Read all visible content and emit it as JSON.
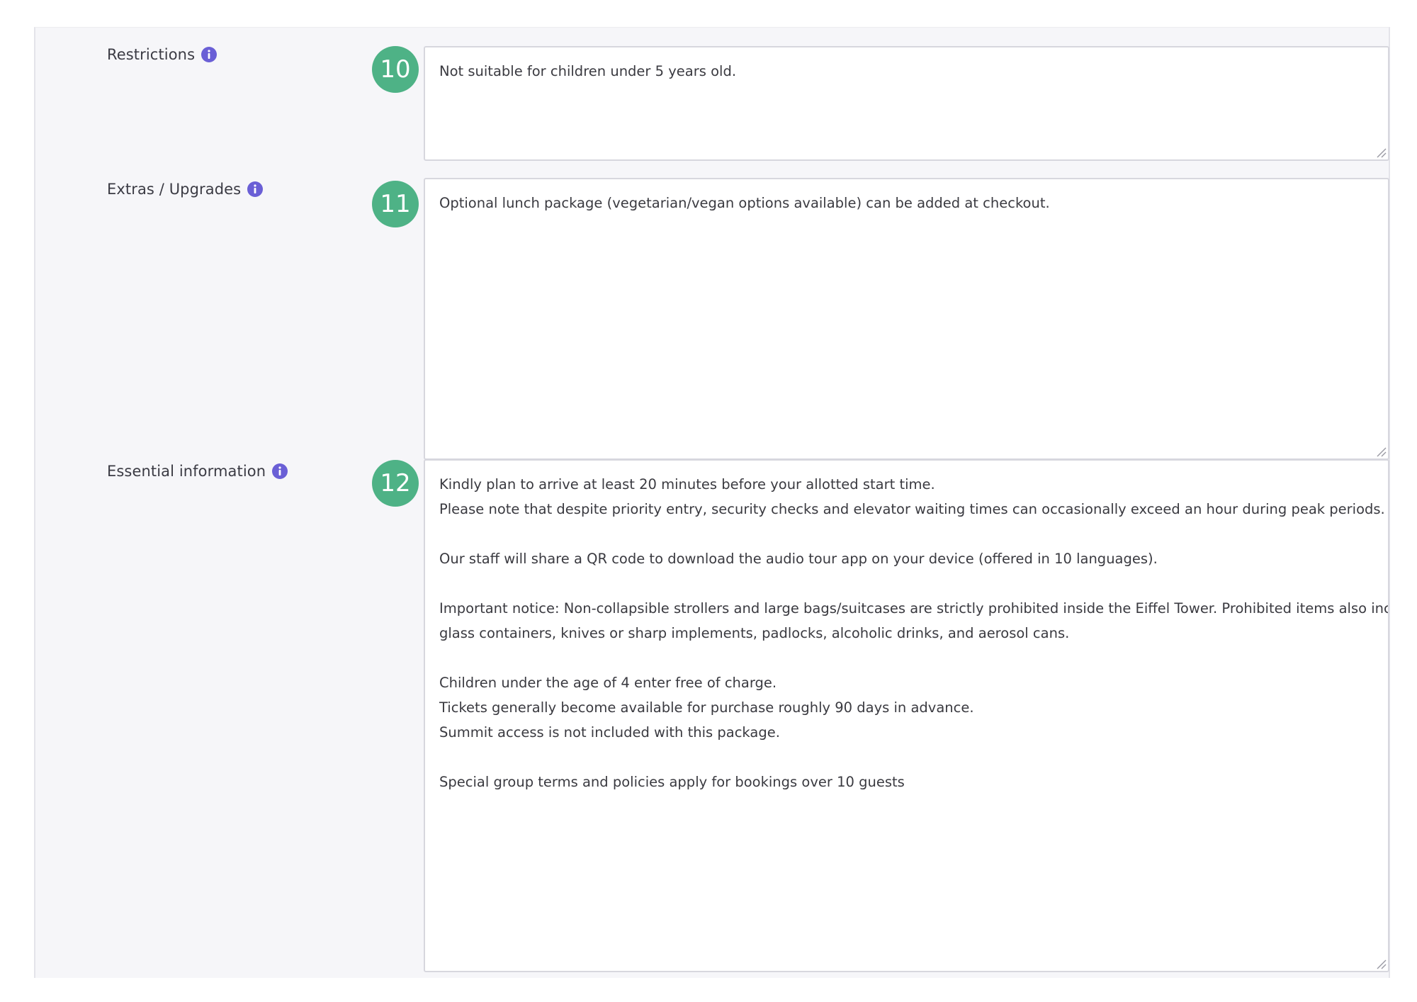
{
  "fields": [
    {
      "label": "Restrictions",
      "step": "10",
      "lines": [
        "Not suitable for children under 5 years old."
      ]
    },
    {
      "label": "Extras / Upgrades",
      "step": "11",
      "lines": [
        "Optional lunch package (vegetarian/vegan options available) can be added at checkout."
      ]
    },
    {
      "label": "Essential information",
      "step": "12",
      "lines": [
        "Kindly plan to arrive at least 20 minutes before your allotted start time.",
        "Please note that despite priority entry, security checks and elevator waiting times can occasionally exceed an hour during peak periods.",
        "",
        "Our staff will share a QR code to download the audio tour app on your device (offered in 10 languages).",
        "",
        "Important notice: Non-collapsible strollers and large bags/suitcases are strictly prohibited inside the Eiffel Tower. Prohibited items also include",
        "glass containers, knives or sharp implements, padlocks, alcoholic drinks, and aerosol cans.",
        "",
        "Children under the age of 4 enter free of charge.",
        "Tickets generally become available for purchase roughly 90 days in advance.",
        "Summit access is not included with this package.",
        "",
        "Special group terms and policies apply for bookings over 10 guests"
      ]
    }
  ],
  "colors": {
    "badge": "#4eb286",
    "info_icon": "#6a5fd6",
    "panel_background": "#f6f6f9",
    "textarea_border": "#d7d7de"
  },
  "icons": {
    "info": "info-icon",
    "resize": "resize-handle-icon"
  }
}
